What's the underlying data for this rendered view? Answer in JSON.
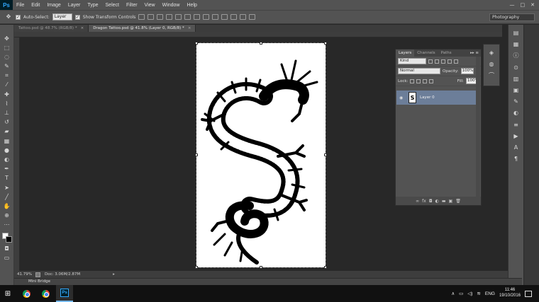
{
  "menubar": {
    "logo": "Ps",
    "items": [
      "File",
      "Edit",
      "Image",
      "Layer",
      "Type",
      "Select",
      "Filter",
      "View",
      "Window",
      "Help"
    ],
    "window_controls": [
      "—",
      "□",
      "✕"
    ]
  },
  "options": {
    "auto_select_label": "Auto-Select:",
    "auto_select_value": "Layer",
    "show_transform_label": "Show Transform Controls",
    "workspace": "Photography"
  },
  "tabs": [
    {
      "label": "Tattoo.psd @ 48.7% (RGB/8) *",
      "close": "×"
    },
    {
      "label": "Dragon Tattoo.psd @ 41.8% (Layer 0, RGB/8) *",
      "close": "×"
    }
  ],
  "status": {
    "zoom": "41.79%",
    "doc": "Doc: 3.06M/2.87M"
  },
  "minibridge": "Mini Bridge",
  "layers_panel": {
    "tabs": [
      "Layers",
      "Channels",
      "Paths"
    ],
    "menu": "▸▸ ≡",
    "kind_label": "Kind",
    "blend_mode": "Normal",
    "opacity_label": "Opacity:",
    "opacity_value": "100%",
    "lock_label": "Lock:",
    "fill_label": "Fill:",
    "fill_value": "100%",
    "layer_name": "Layer 0",
    "footer_icons": [
      "∞",
      "fx",
      "◘",
      "◐",
      "▬",
      "▣",
      "🗑"
    ]
  },
  "taskbar": {
    "tray_lang": "ENG",
    "time": "11:46",
    "date": "19/10/2016"
  },
  "colors": {
    "panel_bg": "#535353",
    "workspace_bg": "#282828",
    "selected_layer": "#6c7e99",
    "ps_blue": "#31a8ff"
  }
}
